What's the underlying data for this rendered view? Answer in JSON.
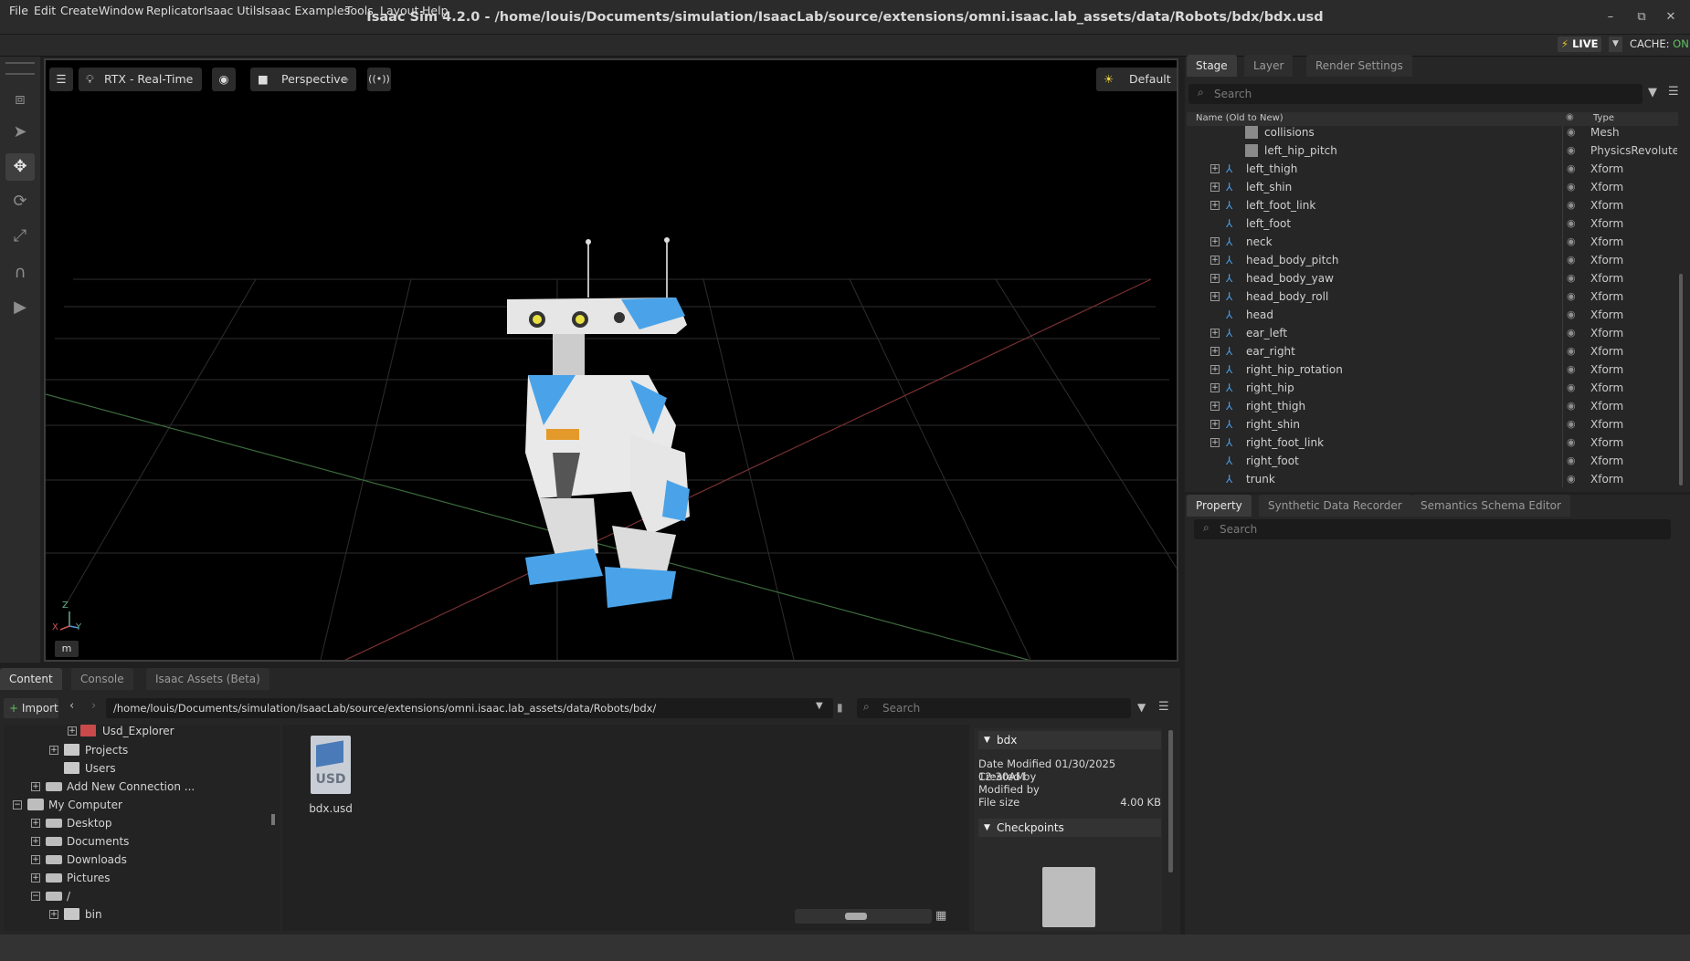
{
  "window": {
    "title": "Isaac Sim 4.2.0 - /home/louis/Documents/simulation/IsaacLab/source/extensions/omni.isaac.lab_assets/data/Robots/bdx/bdx.usd"
  },
  "menu": [
    "File",
    "Edit",
    "Create",
    "Window",
    "Replicator",
    "Isaac Utils",
    "Isaac Examples",
    "Tools",
    "Layout",
    "Help"
  ],
  "live": {
    "label": "LIVE",
    "cache_label": "CACHE:",
    "cache_state": "ON"
  },
  "viewport": {
    "renderer": "RTX - Real-Time",
    "camera": "Perspective",
    "lighting": "Default",
    "unit": "m",
    "axes": {
      "z": "Z",
      "x": "X",
      "y": "Y"
    }
  },
  "stage": {
    "tabs": [
      "Stage",
      "Layer",
      "Render Settings"
    ],
    "search_placeholder": "Search",
    "col_name": "Name (Old to New)",
    "col_type": "Type",
    "rows": [
      {
        "name": "collisions",
        "type": "Mesh"
      },
      {
        "name": "left_hip_pitch",
        "type": "PhysicsRevolute..."
      },
      {
        "name": "left_thigh",
        "type": "Xform"
      },
      {
        "name": "left_shin",
        "type": "Xform"
      },
      {
        "name": "left_foot_link",
        "type": "Xform"
      },
      {
        "name": "left_foot",
        "type": "Xform"
      },
      {
        "name": "neck",
        "type": "Xform"
      },
      {
        "name": "head_body_pitch",
        "type": "Xform"
      },
      {
        "name": "head_body_yaw",
        "type": "Xform"
      },
      {
        "name": "head_body_roll",
        "type": "Xform"
      },
      {
        "name": "head",
        "type": "Xform"
      },
      {
        "name": "ear_left",
        "type": "Xform"
      },
      {
        "name": "ear_right",
        "type": "Xform"
      },
      {
        "name": "right_hip_rotation",
        "type": "Xform"
      },
      {
        "name": "right_hip",
        "type": "Xform"
      },
      {
        "name": "right_thigh",
        "type": "Xform"
      },
      {
        "name": "right_shin",
        "type": "Xform"
      },
      {
        "name": "right_foot_link",
        "type": "Xform"
      },
      {
        "name": "right_foot",
        "type": "Xform"
      },
      {
        "name": "trunk",
        "type": "Xform"
      }
    ]
  },
  "property": {
    "tabs": [
      "Property",
      "Synthetic Data Recorder",
      "Semantics Schema Editor"
    ],
    "search_placeholder": "Search"
  },
  "content": {
    "tabs": [
      "Content",
      "Console",
      "Isaac Assets (Beta)"
    ],
    "import_label": "Import",
    "path": "/home/louis/Documents/simulation/IsaacLab/source/extensions/omni.isaac.lab_assets/data/Robots/bdx/",
    "search_placeholder": "Search",
    "tree": [
      "Usd_Explorer",
      "Projects",
      "Users",
      "Add New Connection ...",
      "My Computer",
      "Desktop",
      "Documents",
      "Downloads",
      "Pictures",
      "/",
      "bin"
    ],
    "file": {
      "name": "bdx.usd",
      "icon_text": "USD"
    },
    "details": {
      "title": "bdx",
      "date_label": "Date Modified",
      "date": "01/30/2025 12:30AM",
      "created_label": "Created by",
      "modified_label": "Modified by",
      "size_label": "File size",
      "size": "4.00 KB",
      "checkpoints": "Checkpoints"
    }
  },
  "colors": {
    "accent": "#4a9ee8",
    "live": "#e8c12a",
    "cache_on": "#60c060",
    "robot_blue": "#4aa3e8"
  }
}
